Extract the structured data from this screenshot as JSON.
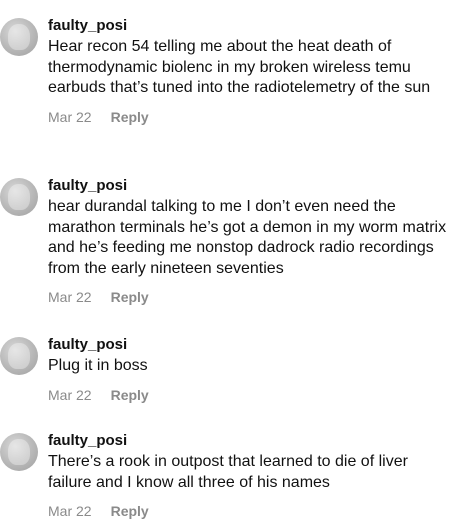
{
  "comments": [
    {
      "username": "faulty_posi",
      "text": "Hear recon 54 telling me about the heat death of thermodynamic biolenc in my broken wireless temu earbuds that’s tuned into the radiotelemetry of the sun",
      "date": "Mar 22",
      "reply_label": "Reply"
    },
    {
      "username": "faulty_posi",
      "text": "hear durandal talking to me I don’t even need the marathon terminals he’s got a demon in my worm matrix and he’s feeding me nonstop dadrock radio recordings from the early nineteen seventies",
      "date": "Mar 22",
      "reply_label": "Reply"
    },
    {
      "username": "faulty_posi",
      "text": "Plug it in boss",
      "date": "Mar 22",
      "reply_label": "Reply"
    },
    {
      "username": "faulty_posi",
      "text": "There’s a rook in outpost that learned to die of liver failure and I know all three of his names",
      "date": "Mar 22",
      "reply_label": "Reply"
    }
  ]
}
